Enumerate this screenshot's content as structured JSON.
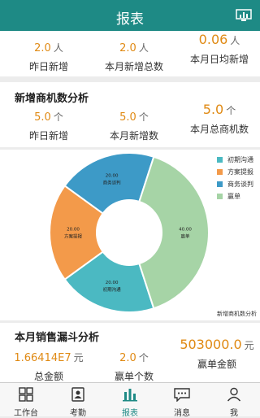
{
  "header": {
    "title": "报表"
  },
  "top_stats": [
    {
      "value": "2.0",
      "unit": "人",
      "label": "昨日新增"
    },
    {
      "value": "2.0",
      "unit": "人",
      "label": "本月新增总数"
    },
    {
      "value": "0.06",
      "unit": "人",
      "label": "本月日均新增"
    }
  ],
  "opportunity": {
    "title": "新增商机数分析",
    "stats": [
      {
        "value": "5.0",
        "unit": "个",
        "label": "昨日新增"
      },
      {
        "value": "5.0",
        "unit": "个",
        "label": "本月新增数"
      },
      {
        "value": "5.0",
        "unit": "个",
        "label": "本月总商机数"
      }
    ]
  },
  "chart_data": {
    "type": "pie",
    "title": "新增商机数分析",
    "categories": [
      "初期沟通",
      "方案提报",
      "商务谈判",
      "赢单"
    ],
    "values": [
      20.0,
      20.0,
      20.0,
      40.0
    ],
    "data_labels": [
      "20.00\n初期沟通",
      "20.00\n方案提报",
      "20.00\n商务谈判",
      "40.00\n赢单"
    ],
    "colors": [
      "#4bb9c2",
      "#f39a4a",
      "#3d9ac7",
      "#a6d4a6"
    ],
    "legend": "top-right",
    "donut": true
  },
  "funnel": {
    "title": "本月销售漏斗分析",
    "stats": [
      {
        "value": "1.66414E7",
        "unit": "元",
        "label": "总金额"
      },
      {
        "value": "2.0",
        "unit": "个",
        "label": "赢单个数"
      },
      {
        "value": "503000.0",
        "unit": "元",
        "label": "赢单金额"
      }
    ]
  },
  "tabbar": {
    "items": [
      {
        "label": "工作台",
        "icon": "grid-icon"
      },
      {
        "label": "考勤",
        "icon": "contact-card-icon"
      },
      {
        "label": "报表",
        "icon": "bar-chart-icon",
        "active": true
      },
      {
        "label": "消息",
        "icon": "chat-bubble-icon"
      },
      {
        "label": "我",
        "icon": "person-icon"
      }
    ]
  },
  "colors": {
    "brand": "#1e8a85",
    "accent": "#e08a14"
  }
}
